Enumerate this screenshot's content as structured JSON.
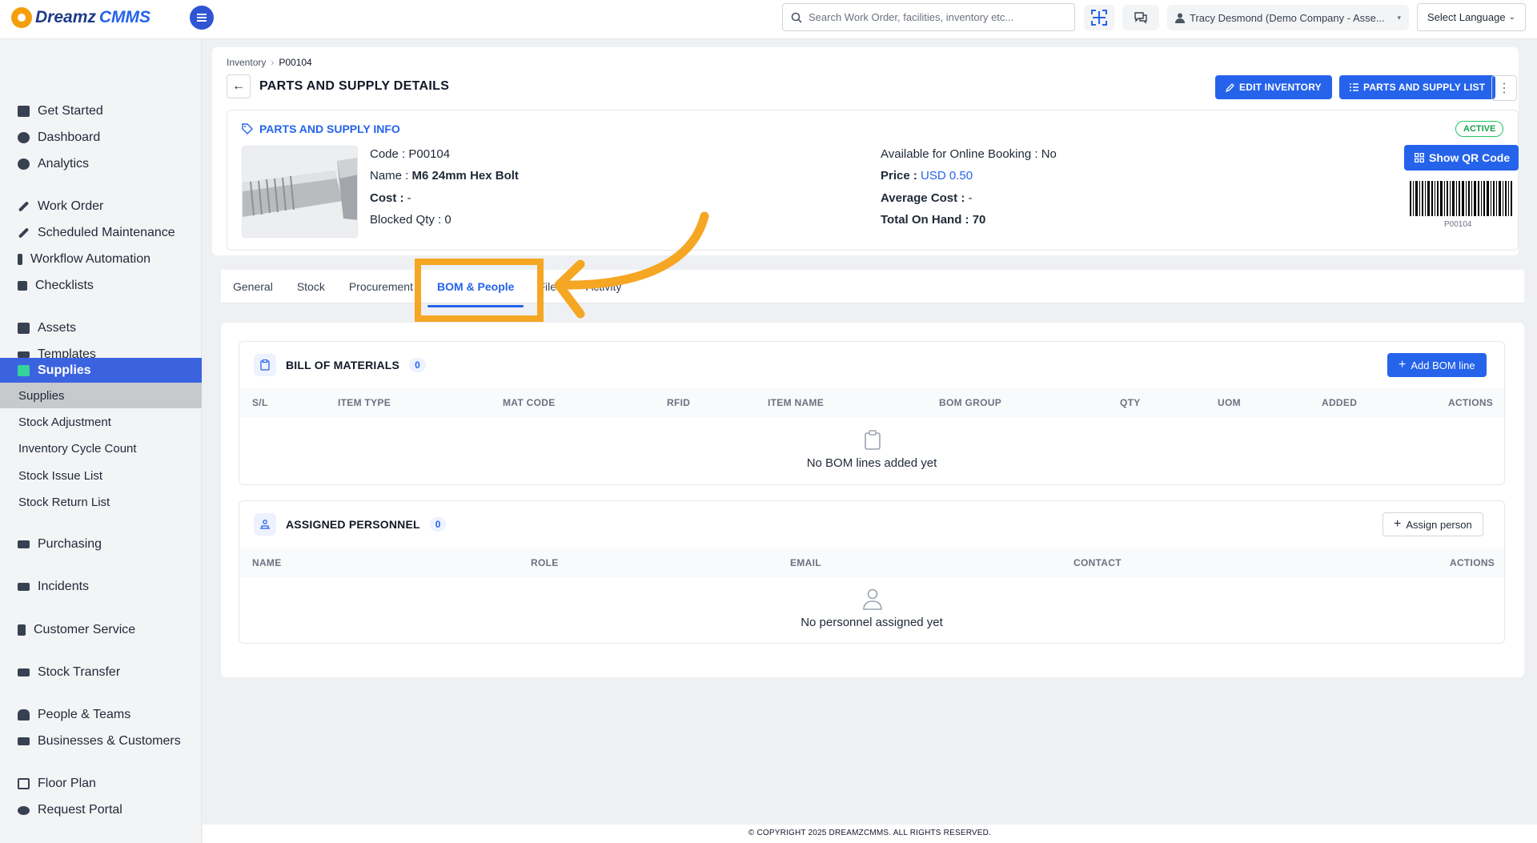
{
  "app": {
    "logo_part1": "Dreamz",
    "logo_part2": "CMMS"
  },
  "topbar": {
    "search_placeholder": "Search Work Order, facilities, inventory etc...",
    "user_label": "Tracy Desmond (Demo Company - Asse...",
    "language": "Select Language"
  },
  "sidebar": {
    "items": [
      {
        "label": "Get Started",
        "icon": "gears-icon"
      },
      {
        "label": "Dashboard",
        "icon": "palette-icon"
      },
      {
        "label": "Analytics",
        "icon": "palette-icon"
      },
      {
        "label": "Work Order",
        "icon": "wrench-icon"
      },
      {
        "label": "Scheduled Maintenance",
        "icon": "wrench-icon"
      },
      {
        "label": "Workflow Automation",
        "icon": "flow-icon"
      },
      {
        "label": "Checklists",
        "icon": "checkbox-icon"
      },
      {
        "label": "Assets",
        "icon": "box-icon"
      },
      {
        "label": "Templates",
        "icon": "shuffle-icon"
      },
      {
        "label": "Supplies",
        "icon": "briefcase-icon"
      },
      {
        "label": "Purchasing",
        "icon": "cart-icon"
      },
      {
        "label": "Incidents",
        "icon": "cart-icon"
      },
      {
        "label": "Customer Service",
        "icon": "file-icon"
      },
      {
        "label": "Stock Transfer",
        "icon": "truck-icon"
      },
      {
        "label": "People & Teams",
        "icon": "users-icon"
      },
      {
        "label": "Businesses & Customers",
        "icon": "video-icon"
      },
      {
        "label": "Floor Plan",
        "icon": "printer-icon"
      },
      {
        "label": "Request Portal",
        "icon": "comment-icon"
      }
    ],
    "sub_items": [
      "Supplies",
      "Stock Adjustment",
      "Inventory Cycle Count",
      "Stock Issue List",
      "Stock Return List"
    ]
  },
  "page": {
    "breadcrumb": [
      "Inventory",
      "P00104"
    ],
    "title": "PARTS AND SUPPLY DETAILS",
    "edit_button": "EDIT INVENTORY",
    "list_button": "PARTS AND SUPPLY LIST"
  },
  "info": {
    "heading": "PARTS AND SUPPLY INFO",
    "status": "ACTIVE",
    "code_label": "Code :",
    "code": "P00104",
    "name_label": "Name :",
    "name": "M6 24mm Hex Bolt",
    "cost_label": "Cost :",
    "cost": "-",
    "blocked_label": "Blocked Qty :",
    "blocked": "0",
    "online_label": "Available for Online Booking :",
    "online": "No",
    "price_label": "Price :",
    "price": "USD 0.50",
    "avg_label": "Average Cost :",
    "avg": "-",
    "onhand_label": "Total On Hand :",
    "onhand": "70",
    "qr_button": "Show QR Code",
    "barcode_text": "P00104"
  },
  "tabs": [
    "General",
    "Stock",
    "Procurement",
    "BOM & People",
    "Files",
    "Activity"
  ],
  "bom": {
    "title": "BILL OF MATERIALS",
    "count": "0",
    "add_button": "Add BOM line",
    "columns": [
      "S/L",
      "ITEM TYPE",
      "MAT CODE",
      "RFID",
      "ITEM NAME",
      "BOM GROUP",
      "QTY",
      "UOM",
      "ADDED",
      "ACTIONS"
    ],
    "empty": "No BOM lines added yet"
  },
  "personnel": {
    "title": "ASSIGNED PERSONNEL",
    "count": "0",
    "assign_button": "Assign person",
    "columns": [
      "NAME",
      "ROLE",
      "EMAIL",
      "CONTACT",
      "ACTIONS"
    ],
    "empty": "No personnel assigned yet"
  },
  "footer": "© COPYRIGHT 2025 DREAMZCMMS. ALL RIGHTS RESERVED.",
  "colors": {
    "primary": "#2563eb",
    "annotation": "#f5a623",
    "active": "#22c55e"
  }
}
